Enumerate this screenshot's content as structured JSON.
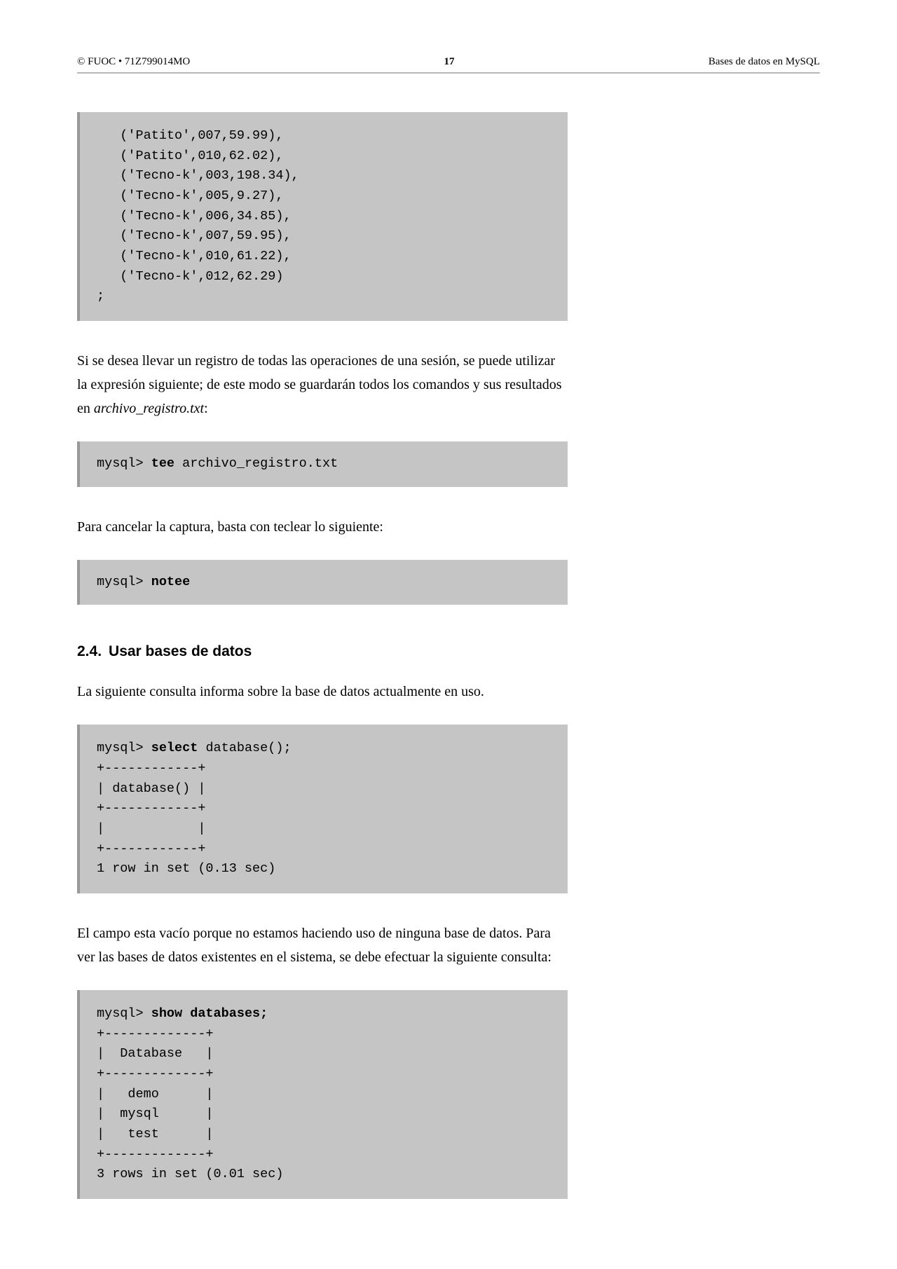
{
  "header": {
    "left": "© FUOC • 71Z799014MO",
    "center": "17",
    "right": "Bases de datos en MySQL"
  },
  "code1": {
    "lines": [
      "   ('Patito',007,59.99),",
      "   ('Patito',010,62.02),",
      "   ('Tecno-k',003,198.34),",
      "   ('Tecno-k',005,9.27),",
      "   ('Tecno-k',006,34.85),",
      "   ('Tecno-k',007,59.95),",
      "   ('Tecno-k',010,61.22),",
      "   ('Tecno-k',012,62.29)",
      ";"
    ]
  },
  "para1_a": "Si se desea llevar un registro de todas las operaciones de una sesión, se puede utilizar la expresión siguiente; de este modo se guardarán todos los comandos y sus resultados en ",
  "para1_ital": "archivo_registro.txt",
  "para1_b": ":",
  "code2": {
    "prefix": "mysql> ",
    "bold": "tee",
    "suffix": " archivo_registro.txt"
  },
  "para2": "Para cancelar la captura, basta con teclear lo siguiente:",
  "code3": {
    "prefix": "mysql> ",
    "bold": "notee"
  },
  "section": {
    "number": "2.4.",
    "title": "Usar bases de datos"
  },
  "para3": "La siguiente consulta informa sobre la base de datos actualmente en uso.",
  "code4": {
    "line1_prefix": "mysql> ",
    "line1_bold": "select",
    "line1_suffix": " database();",
    "rest": [
      "+------------+",
      "| database() |",
      "+------------+",
      "|            |",
      "+------------+",
      "1 row in set (0.13 sec)"
    ]
  },
  "para4": "El campo esta vacío porque no estamos haciendo uso de ninguna base de datos. Para ver las bases de datos existentes en el sistema, se debe efectuar la siguiente consulta:",
  "code5": {
    "line1_prefix": "mysql> ",
    "line1_bold": "show databases;",
    "rest": [
      "+-------------+",
      "|  Database   |",
      "+-------------+",
      "|   demo      |",
      "|  mysql      |",
      "|   test      |",
      "+-------------+",
      "3 rows in set (0.01 sec)"
    ]
  }
}
